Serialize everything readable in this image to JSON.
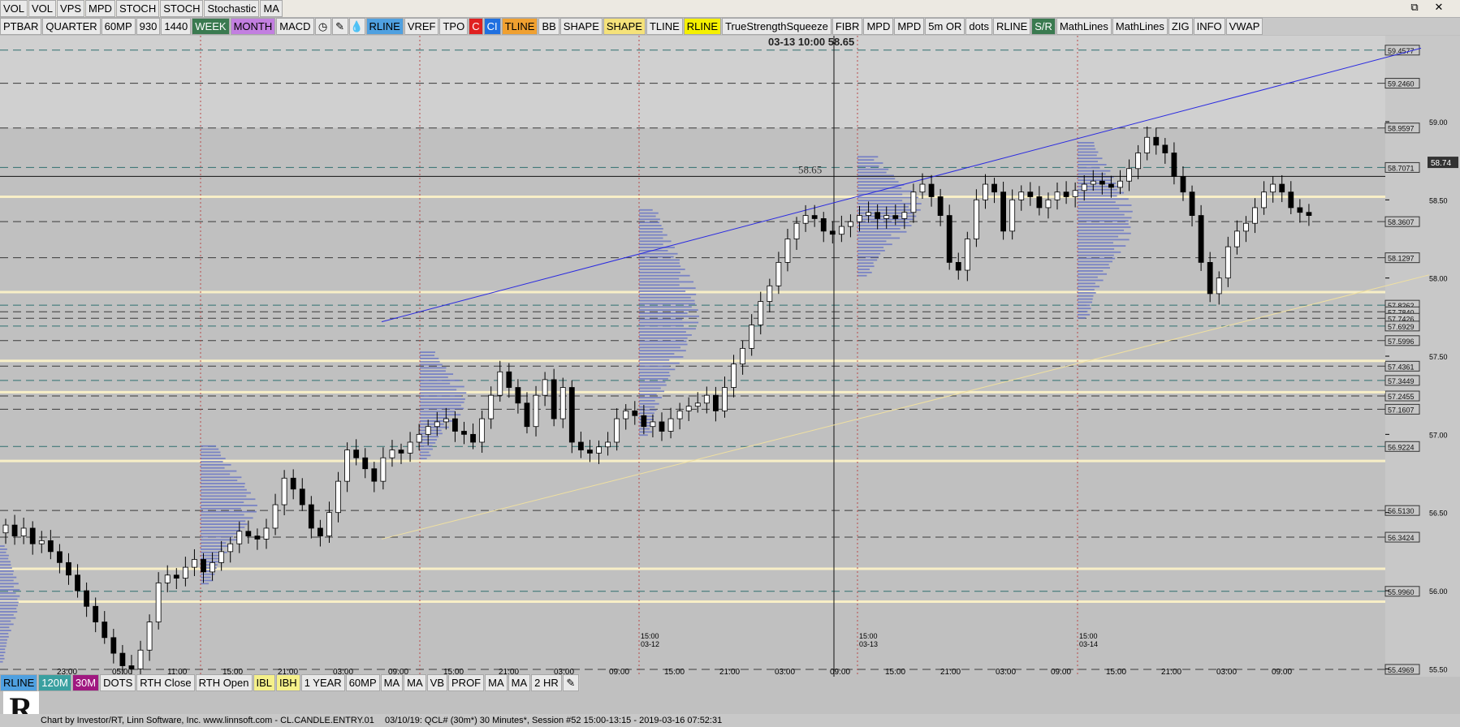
{
  "toolbar_top": [
    {
      "label": "VOL",
      "bg": "#e9e9e9"
    },
    {
      "label": "VOL",
      "bg": "#e9e9e9"
    },
    {
      "label": "VPS",
      "bg": "#e9e9e9"
    },
    {
      "label": "MPD",
      "bg": "#e9e9e9"
    },
    {
      "label": "STOCH",
      "bg": "#e9e9e9"
    },
    {
      "label": "STOCH",
      "bg": "#e9e9e9"
    },
    {
      "label": "Stochastic",
      "bg": "#e9e9e9"
    },
    {
      "label": "MA",
      "bg": "#e9e9e9"
    }
  ],
  "toolbar_main": [
    {
      "label": "PTBAR",
      "bg": "#e9e9e9"
    },
    {
      "label": "QUARTER",
      "bg": "#e9e9e9"
    },
    {
      "label": "60MP",
      "bg": "#e9e9e9"
    },
    {
      "label": "930",
      "bg": "#e9e9e9"
    },
    {
      "label": "1440",
      "bg": "#e9e9e9"
    },
    {
      "label": "WEEK",
      "bg": "#3a7a50"
    },
    {
      "label": "MONTH",
      "bg": "#c27fe0"
    },
    {
      "label": "MACD",
      "bg": "#e9e9e9"
    },
    {
      "icon": "clock-icon",
      "glyph": "◷"
    },
    {
      "icon": "pencil-icon",
      "glyph": "✎"
    },
    {
      "icon": "drop-icon",
      "glyph": "💧"
    },
    {
      "label": "RLINE",
      "bg": "#4fa0e0"
    },
    {
      "label": "VREF",
      "bg": "#e9e9e9"
    },
    {
      "label": "TPO",
      "bg": "#e9e9e9"
    },
    {
      "label": "C",
      "bg": "#e02020"
    },
    {
      "label": "CI",
      "bg": "#2070e0"
    },
    {
      "label": "TLINE",
      "bg": "#f0a030"
    },
    {
      "label": "BB",
      "bg": "#e9e9e9"
    },
    {
      "label": "SHAPE",
      "bg": "#e9e9e9"
    },
    {
      "label": "SHAPE",
      "bg": "#f5e27a"
    },
    {
      "label": "TLINE",
      "bg": "#e9e9e9"
    },
    {
      "label": "RLINE",
      "bg": "#f5f000"
    },
    {
      "label": "TrueStrengthSqueeze",
      "bg": "#e9e9e9"
    },
    {
      "label": "FIBR",
      "bg": "#e9e9e9"
    },
    {
      "label": "MPD",
      "bg": "#e9e9e9"
    },
    {
      "label": "MPD",
      "bg": "#e9e9e9"
    },
    {
      "label": "5m OR",
      "bg": "#e9e9e9"
    },
    {
      "label": "dots",
      "bg": "#e9e9e9"
    },
    {
      "label": "RLINE",
      "bg": "#e9e9e9"
    },
    {
      "label": "S/R",
      "bg": "#3a7a50"
    },
    {
      "label": "MathLines",
      "bg": "#e9e9e9"
    },
    {
      "label": "MathLines",
      "bg": "#e9e9e9"
    },
    {
      "label": "ZIG",
      "bg": "#e9e9e9"
    },
    {
      "label": "INFO",
      "bg": "#e9e9e9"
    },
    {
      "label": "VWAP",
      "bg": "#e9e9e9"
    }
  ],
  "toolbar_bottom": [
    {
      "label": "RLINE",
      "bg": "#4fa0e0"
    },
    {
      "label": "120M",
      "bg": "#3aa0a0"
    },
    {
      "label": "30M",
      "bg": "#a01880"
    },
    {
      "label": "DOTS",
      "bg": "#e9e9e9"
    },
    {
      "label": "RTH Close",
      "bg": "#e9e9e9"
    },
    {
      "label": "RTH Open",
      "bg": "#e9e9e9"
    },
    {
      "label": "IBL",
      "bg": "#f5f08a"
    },
    {
      "label": "IBH",
      "bg": "#f5f08a"
    },
    {
      "label": "1 YEAR",
      "bg": "#e9e9e9"
    },
    {
      "label": "60MP",
      "bg": "#e9e9e9"
    },
    {
      "label": "MA",
      "bg": "#e9e9e9"
    },
    {
      "label": "MA",
      "bg": "#e9e9e9"
    },
    {
      "label": "VB",
      "bg": "#e9e9e9"
    },
    {
      "label": "PROF",
      "bg": "#e9e9e9"
    },
    {
      "label": "MA",
      "bg": "#e9e9e9"
    },
    {
      "label": "MA",
      "bg": "#e9e9e9"
    },
    {
      "label": "2 HR",
      "bg": "#e9e9e9"
    },
    {
      "icon": "pencil-icon",
      "glyph": "✎"
    }
  ],
  "window_controls": [
    "⧉",
    "✕"
  ],
  "crosshair": {
    "readout": "03-13 10:00  58.65",
    "level_label": "58.65"
  },
  "last_price": "58.74",
  "status_bar": {
    "credit": "Chart by Investor/RT, Linn Software, Inc. www.linnsoft.com - CL.CANDLE.ENTRY.01",
    "info": "03/10/19: QCL# (30m*) 30 Minutes*, Session #52 15:00-13:15 - 2019-03-16 07:52:31"
  },
  "logo_letter": "R",
  "colors": {
    "bg": "#c0c0c0",
    "shade": "#d0d0d0",
    "vp": "#6c78c4",
    "ivory": "#fff5c8",
    "trend": "#2a2ae0",
    "up": "#ffffff",
    "down": "#000000"
  },
  "chart_data": {
    "type": "candlestick",
    "symbol": "QCL#",
    "interval": "30 Minutes",
    "ylim": [
      55.45,
      59.55
    ],
    "price_ticks": [
      "59.00",
      "58.50",
      "58.00",
      "57.50",
      "57.00",
      "56.50",
      "56.00",
      "55.50"
    ],
    "level_labels": [
      "59.4577",
      "59.2460",
      "58.9597",
      "58.7071",
      "58.3607",
      "58.1297",
      "57.8262",
      "57.7840",
      "57.7426",
      "57.6929",
      "57.5996",
      "57.4361",
      "57.3449",
      "57.2455",
      "57.1607",
      "56.9224",
      "56.5130",
      "56.3424",
      "55.9960",
      "55.4969"
    ],
    "time_labels": [
      "23:00",
      "05:00",
      "11:00",
      "15:00",
      "21:00",
      "03:00",
      "09:00",
      "15:00",
      "21:00",
      "03:00",
      "09:00",
      "15:00",
      "21:00",
      "03:00",
      "09:00",
      "15:00",
      "21:00",
      "03:00",
      "09:00",
      "15:00",
      "21:00",
      "03:00",
      "09:00"
    ],
    "session_labels": [
      {
        "time": "15:00",
        "date": "03-12"
      },
      {
        "time": "15:00",
        "date": "03-13"
      },
      {
        "time": "15:00",
        "date": "03-14"
      }
    ],
    "closes": [
      56.42,
      56.35,
      56.4,
      56.3,
      56.32,
      56.25,
      56.18,
      56.1,
      56.0,
      55.9,
      55.8,
      55.7,
      55.6,
      55.52,
      55.5,
      55.62,
      55.8,
      56.05,
      56.1,
      56.08,
      56.15,
      56.2,
      56.12,
      56.18,
      56.25,
      56.3,
      56.38,
      56.35,
      56.33,
      56.4,
      56.55,
      56.72,
      56.65,
      56.55,
      56.4,
      56.35,
      56.5,
      56.7,
      56.9,
      56.85,
      56.78,
      56.7,
      56.85,
      56.9,
      56.88,
      56.95,
      57.0,
      57.05,
      57.08,
      57.1,
      57.02,
      57.0,
      56.95,
      57.1,
      57.25,
      57.4,
      57.3,
      57.2,
      57.05,
      57.25,
      57.35,
      57.1,
      57.3,
      56.95,
      56.9,
      56.88,
      56.92,
      56.95,
      57.1,
      57.15,
      57.12,
      57.05,
      57.08,
      57.02,
      57.1,
      57.15,
      57.18,
      57.2,
      57.25,
      57.15,
      57.3,
      57.45,
      57.55,
      57.7,
      57.85,
      57.95,
      58.1,
      58.25,
      58.35,
      58.4,
      58.38,
      58.3,
      58.28,
      58.33,
      58.36,
      58.4,
      58.42,
      58.38,
      58.4,
      58.38,
      58.42,
      58.55,
      58.6,
      58.52,
      58.4,
      58.1,
      58.05,
      58.25,
      58.5,
      58.6,
      58.55,
      58.3,
      58.5,
      58.55,
      58.52,
      58.45,
      58.5,
      58.55,
      58.52,
      58.56,
      58.6,
      58.62,
      58.6,
      58.58,
      58.62,
      58.7,
      58.8,
      58.9,
      58.85,
      58.8,
      58.65,
      58.55,
      58.4,
      58.1,
      57.9,
      58.0,
      58.2,
      58.3,
      58.35,
      58.45,
      58.55,
      58.6,
      58.55,
      58.45,
      58.42,
      58.4
    ]
  }
}
